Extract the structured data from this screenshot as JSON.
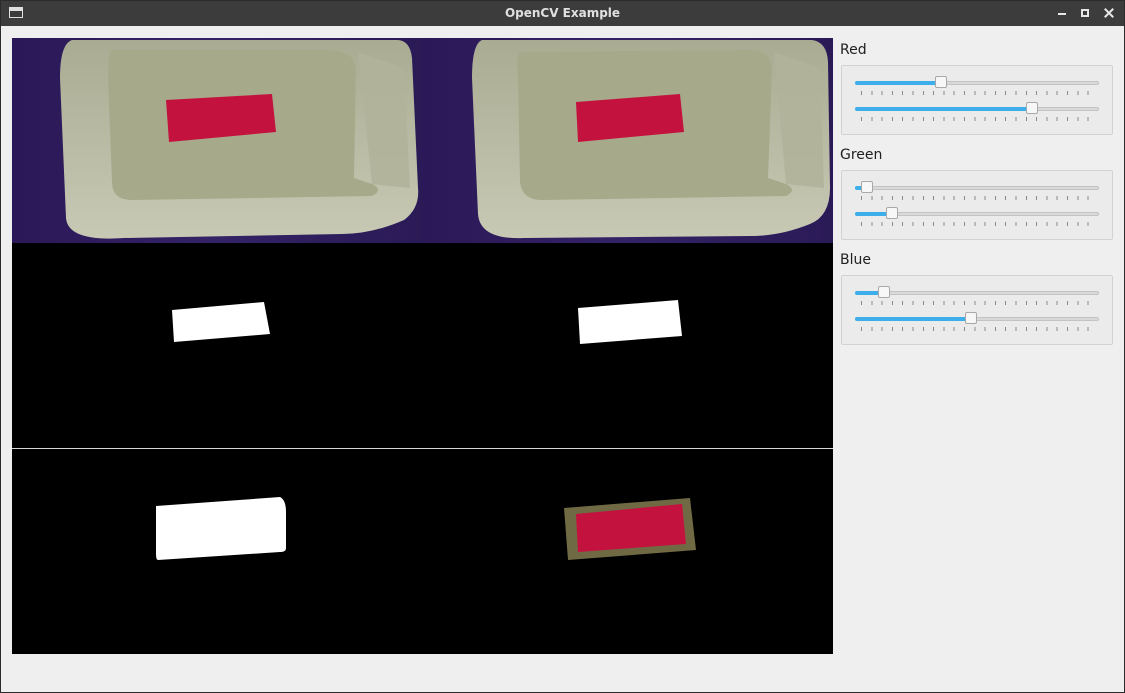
{
  "window": {
    "title": "OpenCV Example",
    "icons": {
      "app": "window-icon",
      "minimize": "minimize-icon",
      "maximize": "maximize-icon",
      "close": "close-icon"
    }
  },
  "colors": {
    "titlebar": "#3c3c3c",
    "accent": "#3daee9",
    "tray_rim": "#b9b9a0",
    "tray_inner": "#a7ab8b",
    "background_purple": "#2c1d52",
    "red_card": "#c8103f",
    "mask_white": "#ffffff",
    "result_halo": "#6f6a44"
  },
  "controls": {
    "groups": [
      {
        "label": "Red",
        "sliders": [
          {
            "name": "red-min-slider",
            "value": 0.345
          },
          {
            "name": "red-max-slider",
            "value": 0.737
          }
        ]
      },
      {
        "label": "Green",
        "sliders": [
          {
            "name": "green-min-slider",
            "value": 0.025
          },
          {
            "name": "green-max-slider",
            "value": 0.135
          }
        ]
      },
      {
        "label": "Blue",
        "sliders": [
          {
            "name": "blue-min-slider",
            "value": 0.1
          },
          {
            "name": "blue-max-slider",
            "value": 0.475
          }
        ]
      }
    ]
  }
}
